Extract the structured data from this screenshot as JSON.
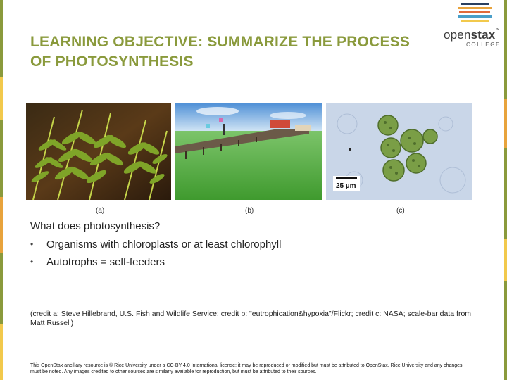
{
  "slide": {
    "title": "LEARNING OBJECTIVE: SUMMARIZE THE PROCESS OF PHOTOSYNTHESIS",
    "accent_color": "#8a9a3c"
  },
  "logo": {
    "word_light": "open",
    "word_bold": "stax",
    "tm": "™",
    "sub": "COLLEGE",
    "bar_colors": [
      "#2a3f5f",
      "#e8a33c",
      "#e26b3b",
      "#4a9fc9",
      "#f2c94c"
    ]
  },
  "figure": {
    "labels": [
      "(a)",
      "(b)",
      "(c)"
    ],
    "scale_bar": "25 µm"
  },
  "content": {
    "question": "What does photosynthesis?",
    "bullets": [
      "Organisms with chloroplasts or at least chlorophyll",
      "Autotrophs = self-feeders"
    ],
    "credit": "(credit a: Steve Hillebrand, U.S. Fish and Wildlife Service; credit b: \"eutrophication&hypoxia\"/Flickr; credit c: NASA; scale-bar data from Matt Russell)"
  },
  "footer": {
    "text": "This OpenStax ancillary resource is © Rice University under a CC-BY 4.0 International license; it may be reproduced or modified but must be attributed to OpenStax, Rice University and any changes must be noted. Any images credited to other sources are similarly available for reproduction, but must be attributed to their sources."
  }
}
